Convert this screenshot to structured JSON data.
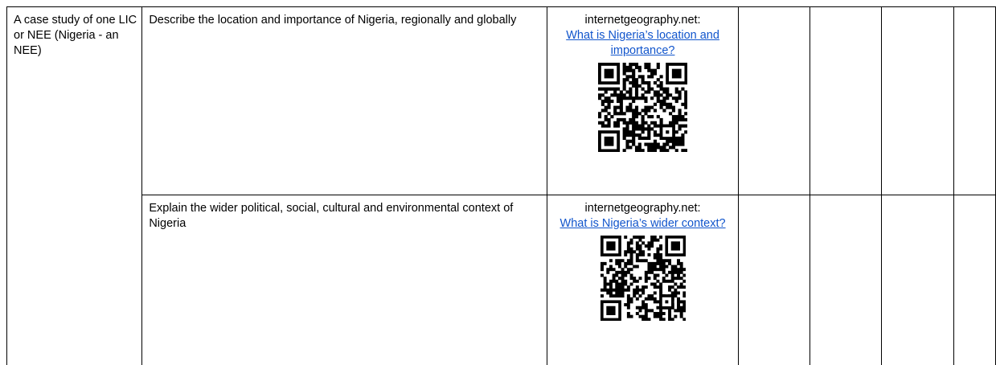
{
  "table": {
    "topic": "A case study of one LIC or NEE (Nigeria - an NEE)",
    "rows": [
      {
        "description": "Describe the location and importance of Nigeria, regionally and globally",
        "source": "internetgeography.net:",
        "link": "What is Nigeria’s location and importance?"
      },
      {
        "description": "Explain the wider political, social, cultural and environmental context of Nigeria",
        "source": "internetgeography.net:",
        "link": "What is Nigeria’s wider context?"
      }
    ]
  },
  "colors": {
    "link": "#1155cc",
    "border": "#000000",
    "qr": "#000000"
  }
}
